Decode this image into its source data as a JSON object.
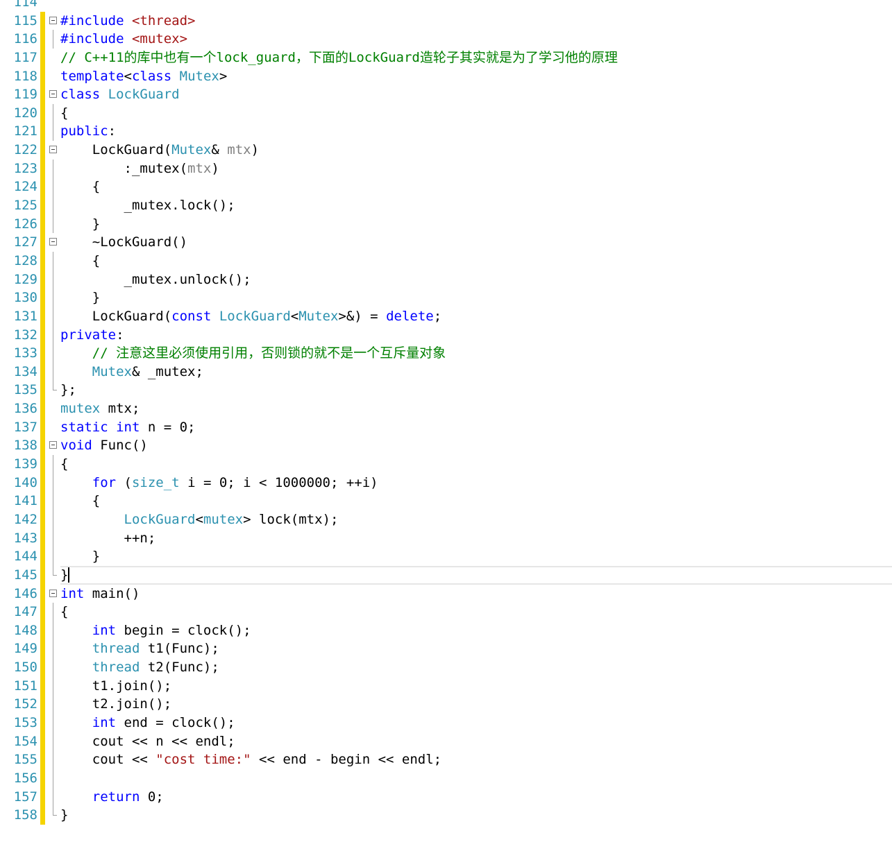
{
  "editor": {
    "lines": [
      {
        "n": "114",
        "tokens": []
      },
      {
        "n": "115",
        "tokens": [
          {
            "t": "#include ",
            "c": "kw"
          },
          {
            "t": "<thread>",
            "c": "str"
          }
        ]
      },
      {
        "n": "116",
        "tokens": [
          {
            "t": "#include ",
            "c": "kw"
          },
          {
            "t": "<mutex>",
            "c": "str"
          }
        ]
      },
      {
        "n": "117",
        "tokens": [
          {
            "t": "// C++11的库中也有一个lock_guard，下面的LockGuard造轮子其实就是为了学习他的原理",
            "c": "cmt"
          }
        ]
      },
      {
        "n": "118",
        "tokens": [
          {
            "t": "template",
            "c": "kw"
          },
          {
            "t": "<",
            "c": "plain"
          },
          {
            "t": "class",
            "c": "kw"
          },
          {
            "t": " ",
            "c": "plain"
          },
          {
            "t": "Mutex",
            "c": "type"
          },
          {
            "t": ">",
            "c": "plain"
          }
        ]
      },
      {
        "n": "119",
        "tokens": [
          {
            "t": "class",
            "c": "kw"
          },
          {
            "t": " ",
            "c": "plain"
          },
          {
            "t": "LockGuard",
            "c": "type"
          }
        ]
      },
      {
        "n": "120",
        "tokens": [
          {
            "t": "{",
            "c": "plain"
          }
        ]
      },
      {
        "n": "121",
        "tokens": [
          {
            "t": "public",
            "c": "kw"
          },
          {
            "t": ":",
            "c": "plain"
          }
        ]
      },
      {
        "n": "122",
        "tokens": [
          {
            "t": "    LockGuard(",
            "c": "plain"
          },
          {
            "t": "Mutex",
            "c": "type"
          },
          {
            "t": "& ",
            "c": "plain"
          },
          {
            "t": "mtx",
            "c": "param"
          },
          {
            "t": ")",
            "c": "plain"
          }
        ]
      },
      {
        "n": "123",
        "tokens": [
          {
            "t": "        :_mutex(",
            "c": "plain"
          },
          {
            "t": "mtx",
            "c": "param"
          },
          {
            "t": ")",
            "c": "plain"
          }
        ]
      },
      {
        "n": "124",
        "tokens": [
          {
            "t": "    {",
            "c": "plain"
          }
        ]
      },
      {
        "n": "125",
        "tokens": [
          {
            "t": "        _mutex.lock();",
            "c": "plain"
          }
        ]
      },
      {
        "n": "126",
        "tokens": [
          {
            "t": "    }",
            "c": "plain"
          }
        ]
      },
      {
        "n": "127",
        "tokens": [
          {
            "t": "    ~LockGuard()",
            "c": "plain"
          }
        ]
      },
      {
        "n": "128",
        "tokens": [
          {
            "t": "    {",
            "c": "plain"
          }
        ]
      },
      {
        "n": "129",
        "tokens": [
          {
            "t": "        _mutex.unlock();",
            "c": "plain"
          }
        ]
      },
      {
        "n": "130",
        "tokens": [
          {
            "t": "    }",
            "c": "plain"
          }
        ]
      },
      {
        "n": "131",
        "tokens": [
          {
            "t": "    LockGuard(",
            "c": "plain"
          },
          {
            "t": "const",
            "c": "kw"
          },
          {
            "t": " ",
            "c": "plain"
          },
          {
            "t": "LockGuard",
            "c": "type"
          },
          {
            "t": "<",
            "c": "plain"
          },
          {
            "t": "Mutex",
            "c": "type"
          },
          {
            "t": ">&) = ",
            "c": "plain"
          },
          {
            "t": "delete",
            "c": "kw"
          },
          {
            "t": ";",
            "c": "plain"
          }
        ]
      },
      {
        "n": "132",
        "tokens": [
          {
            "t": "private",
            "c": "kw"
          },
          {
            "t": ":",
            "c": "plain"
          }
        ]
      },
      {
        "n": "133",
        "tokens": [
          {
            "t": "    // 注意这里必须使用引用，否则锁的就不是一个互斥量对象",
            "c": "cmt"
          }
        ]
      },
      {
        "n": "134",
        "tokens": [
          {
            "t": "    ",
            "c": "plain"
          },
          {
            "t": "Mutex",
            "c": "type"
          },
          {
            "t": "& _mutex;",
            "c": "plain"
          }
        ]
      },
      {
        "n": "135",
        "tokens": [
          {
            "t": "};",
            "c": "plain"
          }
        ]
      },
      {
        "n": "136",
        "tokens": [
          {
            "t": "mutex",
            "c": "type"
          },
          {
            "t": " mtx;",
            "c": "plain"
          }
        ]
      },
      {
        "n": "137",
        "tokens": [
          {
            "t": "static",
            "c": "kw"
          },
          {
            "t": " ",
            "c": "plain"
          },
          {
            "t": "int",
            "c": "kw"
          },
          {
            "t": " n = 0;",
            "c": "plain"
          }
        ]
      },
      {
        "n": "138",
        "tokens": [
          {
            "t": "void",
            "c": "kw"
          },
          {
            "t": " Func()",
            "c": "plain"
          }
        ]
      },
      {
        "n": "139",
        "tokens": [
          {
            "t": "{",
            "c": "plain"
          }
        ]
      },
      {
        "n": "140",
        "tokens": [
          {
            "t": "    ",
            "c": "plain"
          },
          {
            "t": "for",
            "c": "kw"
          },
          {
            "t": " (",
            "c": "plain"
          },
          {
            "t": "size_t",
            "c": "type"
          },
          {
            "t": " i = 0; i < 1000000; ++i)",
            "c": "plain"
          }
        ]
      },
      {
        "n": "141",
        "tokens": [
          {
            "t": "    {",
            "c": "plain"
          }
        ]
      },
      {
        "n": "142",
        "tokens": [
          {
            "t": "        ",
            "c": "plain"
          },
          {
            "t": "LockGuard",
            "c": "type"
          },
          {
            "t": "<",
            "c": "plain"
          },
          {
            "t": "mutex",
            "c": "type"
          },
          {
            "t": "> lock(mtx);",
            "c": "plain"
          }
        ]
      },
      {
        "n": "143",
        "tokens": [
          {
            "t": "        ++n;",
            "c": "plain"
          }
        ]
      },
      {
        "n": "144",
        "tokens": [
          {
            "t": "    }",
            "c": "plain"
          }
        ]
      },
      {
        "n": "145",
        "tokens": [
          {
            "t": "}",
            "c": "plain"
          }
        ]
      },
      {
        "n": "146",
        "tokens": [
          {
            "t": "int",
            "c": "kw"
          },
          {
            "t": " main()",
            "c": "plain"
          }
        ]
      },
      {
        "n": "147",
        "tokens": [
          {
            "t": "{",
            "c": "plain"
          }
        ]
      },
      {
        "n": "148",
        "tokens": [
          {
            "t": "    ",
            "c": "plain"
          },
          {
            "t": "int",
            "c": "kw"
          },
          {
            "t": " begin = clock();",
            "c": "plain"
          }
        ]
      },
      {
        "n": "149",
        "tokens": [
          {
            "t": "    ",
            "c": "plain"
          },
          {
            "t": "thread",
            "c": "type"
          },
          {
            "t": " t1(Func);",
            "c": "plain"
          }
        ]
      },
      {
        "n": "150",
        "tokens": [
          {
            "t": "    ",
            "c": "plain"
          },
          {
            "t": "thread",
            "c": "type"
          },
          {
            "t": " t2(Func);",
            "c": "plain"
          }
        ]
      },
      {
        "n": "151",
        "tokens": [
          {
            "t": "    t1.join();",
            "c": "plain"
          }
        ]
      },
      {
        "n": "152",
        "tokens": [
          {
            "t": "    t2.join();",
            "c": "plain"
          }
        ]
      },
      {
        "n": "153",
        "tokens": [
          {
            "t": "    ",
            "c": "plain"
          },
          {
            "t": "int",
            "c": "kw"
          },
          {
            "t": " end = clock();",
            "c": "plain"
          }
        ]
      },
      {
        "n": "154",
        "tokens": [
          {
            "t": "    cout << n << endl;",
            "c": "plain"
          }
        ]
      },
      {
        "n": "155",
        "tokens": [
          {
            "t": "    cout << ",
            "c": "plain"
          },
          {
            "t": "\"cost time:\"",
            "c": "str"
          },
          {
            "t": " << end - begin << endl;",
            "c": "plain"
          }
        ]
      },
      {
        "n": "156",
        "tokens": []
      },
      {
        "n": "157",
        "tokens": [
          {
            "t": "    ",
            "c": "plain"
          },
          {
            "t": "return",
            "c": "kw"
          },
          {
            "t": " 0;",
            "c": "plain"
          }
        ]
      },
      {
        "n": "158",
        "tokens": [
          {
            "t": "}",
            "c": "plain"
          }
        ]
      }
    ],
    "fold_lines": [
      "115",
      "119",
      "122",
      "127",
      "138",
      "146"
    ],
    "guide_lines": [
      "116",
      "120",
      "121",
      "123",
      "124",
      "125",
      "126",
      "128",
      "129",
      "130",
      "131",
      "132",
      "133",
      "134",
      "139",
      "140",
      "141",
      "142",
      "143",
      "144",
      "147",
      "148",
      "149",
      "150",
      "151",
      "152",
      "153",
      "154",
      "155",
      "156",
      "157"
    ],
    "guide_end_lines": [
      "135",
      "145",
      "158"
    ],
    "current_line": "145",
    "colors": {
      "keyword": "#0000ff",
      "type": "#2b91af",
      "comment": "#008000",
      "string": "#a31515",
      "line_number": "#2b91af",
      "change_bar": "#f5d400"
    }
  }
}
